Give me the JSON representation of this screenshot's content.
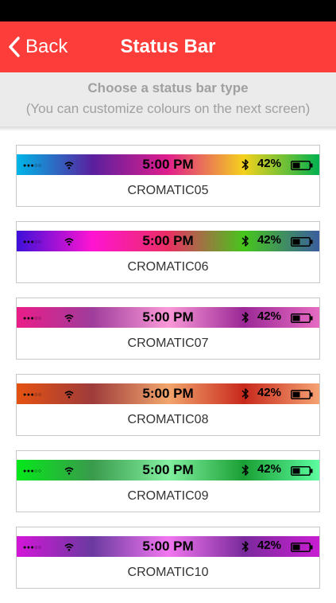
{
  "nav": {
    "back_label": "Back",
    "title": "Status Bar"
  },
  "instructions": {
    "line1": "Choose a status bar type",
    "line2": "(You can customize colours on the next screen)"
  },
  "preview": {
    "signal": "●●●○○",
    "time": "5:00 PM",
    "battery": "42%"
  },
  "options": [
    {
      "label": "CROMATIC05",
      "colors": [
        "#00b6e8",
        "#5a1f9e",
        "#e01e8c",
        "#f4d21c",
        "#00b14f"
      ]
    },
    {
      "label": "CROMATIC06",
      "colors": [
        "#3d10d8",
        "#ff14d2",
        "#ea2e63",
        "#46c61c",
        "#3a5d9e"
      ]
    },
    {
      "label": "CROMATIC07",
      "colors": [
        "#ea1c88",
        "#9f3d9c",
        "#fa99d8",
        "#9b2896",
        "#e66cc2"
      ]
    },
    {
      "label": "CROMATIC08",
      "colors": [
        "#e55212",
        "#9e3b3b",
        "#f2a66d",
        "#c8281c",
        "#f5a373"
      ]
    },
    {
      "label": "CROMATIC09",
      "colors": [
        "#05e81a",
        "#3a9a4c",
        "#82f0a0",
        "#1a9f34",
        "#5cfca0"
      ]
    },
    {
      "label": "CROMATIC10",
      "colors": [
        "#d316d8",
        "#6a3aa0",
        "#f277f0",
        "#7a2a9c",
        "#c91ed2"
      ]
    }
  ]
}
